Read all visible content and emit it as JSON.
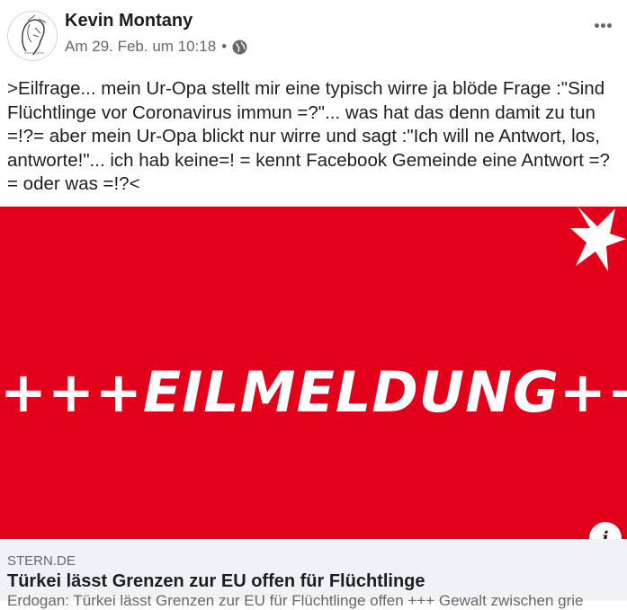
{
  "post": {
    "author": "Kevin Montany",
    "date": "Am 29. Feb. um 10:18",
    "separator": "•",
    "privacy_icon": "globe-icon",
    "more_icon": "more-options-icon",
    "text": ">Eilfrage... mein Ur-Opa stellt mir eine typisch wirre ja blöde Frage :\"Sind Flüchtlinge vor Coronavirus immun =?\"... was hat das denn damit zu tun =!?= aber mein Ur-Opa blickt nur wirre und sagt :\"Ich will ne Antwort, los, antworte!\"... ich hab keine=! = kennt Facebook Gemeinde eine Antwort =? = oder was =!?<"
  },
  "image": {
    "headline": "+++EILMELDUNG+++",
    "background_color": "#e2001a",
    "logo": "stern-star-logo",
    "info_label": "i"
  },
  "link": {
    "domain": "STERN.DE",
    "title": "Türkei lässt Grenzen zur EU offen für Flüchtlinge",
    "description": "Erdogan: Türkei lässt Grenzen zur EU für Flüchtlinge offen +++ Gewalt zwischen grie"
  }
}
